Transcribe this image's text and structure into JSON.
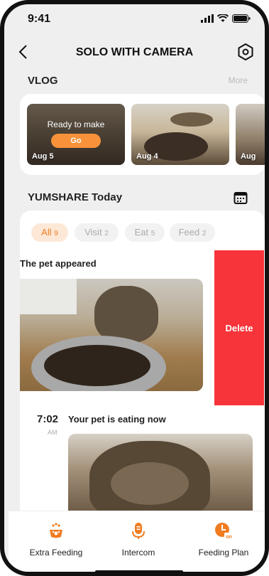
{
  "status_bar": {
    "time": "9:41"
  },
  "header": {
    "title": "SOLO WITH CAMERA"
  },
  "vlog": {
    "title": "VLOG",
    "more_label": "More",
    "items": [
      {
        "date": "Aug 5",
        "ready_text": "Ready to make",
        "go_label": "Go"
      },
      {
        "date": "Aug 4"
      },
      {
        "date": "Aug"
      }
    ]
  },
  "today": {
    "title": "YUMSHARE Today",
    "filters": [
      {
        "label": "All",
        "count": "9"
      },
      {
        "label": "Visit",
        "count": "2"
      },
      {
        "label": "Eat",
        "count": "5"
      },
      {
        "label": "Feed",
        "count": "2"
      }
    ],
    "events": [
      {
        "title": "The pet appeared"
      },
      {
        "time": "7:02",
        "ampm": "AM",
        "title": "Your pet is eating now"
      }
    ],
    "delete_label": "Delete"
  },
  "bottom_bar": {
    "items": [
      {
        "label": "Extra Feeding",
        "icon": "extra-feeding-icon"
      },
      {
        "label": "Intercom",
        "icon": "microphone-icon"
      },
      {
        "label": "Feeding Plan",
        "icon": "feeding-plan-icon"
      }
    ]
  },
  "colors": {
    "accent": "#f7923a",
    "delete": "#f7343a",
    "chip_active_bg": "#fde8d7"
  }
}
